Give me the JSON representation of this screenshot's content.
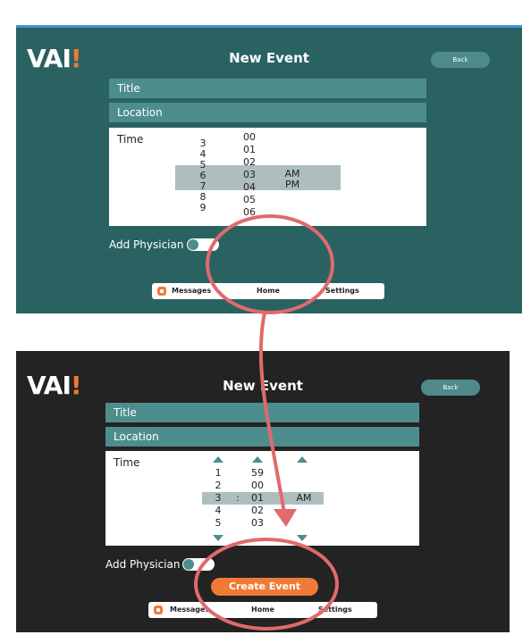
{
  "colors": {
    "teal_bg": "#2a6262",
    "dark_bg": "#232323",
    "field": "#4d8d8d",
    "accent": "#f07a35",
    "annotation": "#e06a6e"
  },
  "top_screen": {
    "logo": "VAI",
    "logo_bang": "!",
    "title": "New Event",
    "back_label": "Back",
    "title_field": "Title",
    "location_field": "Location",
    "time_label": "Time",
    "hours": [
      "3",
      "4",
      "5",
      "6",
      "7",
      "8",
      "9"
    ],
    "minutes": [
      "00",
      "01",
      "02",
      "03",
      "04",
      "05",
      "06"
    ],
    "ampm": [
      "AM",
      "PM"
    ],
    "add_physician": "Add Physician",
    "tabs": {
      "messages": "Messages",
      "home": "Home",
      "settings": "Settings"
    }
  },
  "bottom_screen": {
    "logo": "VAI",
    "logo_bang": "!",
    "title": "New Event",
    "back_label": "Back",
    "title_field": "Title",
    "location_field": "Location",
    "time_label": "Time",
    "hours": [
      "1",
      "2",
      "3",
      "4",
      "5"
    ],
    "separator": ":",
    "minutes": [
      "59",
      "00",
      "01",
      "02",
      "03"
    ],
    "ampm": "AM",
    "add_physician": "Add Physician",
    "create_event": "Create Event",
    "tabs": {
      "messages": "Messages",
      "home": "Home",
      "settings": "Settings"
    }
  }
}
